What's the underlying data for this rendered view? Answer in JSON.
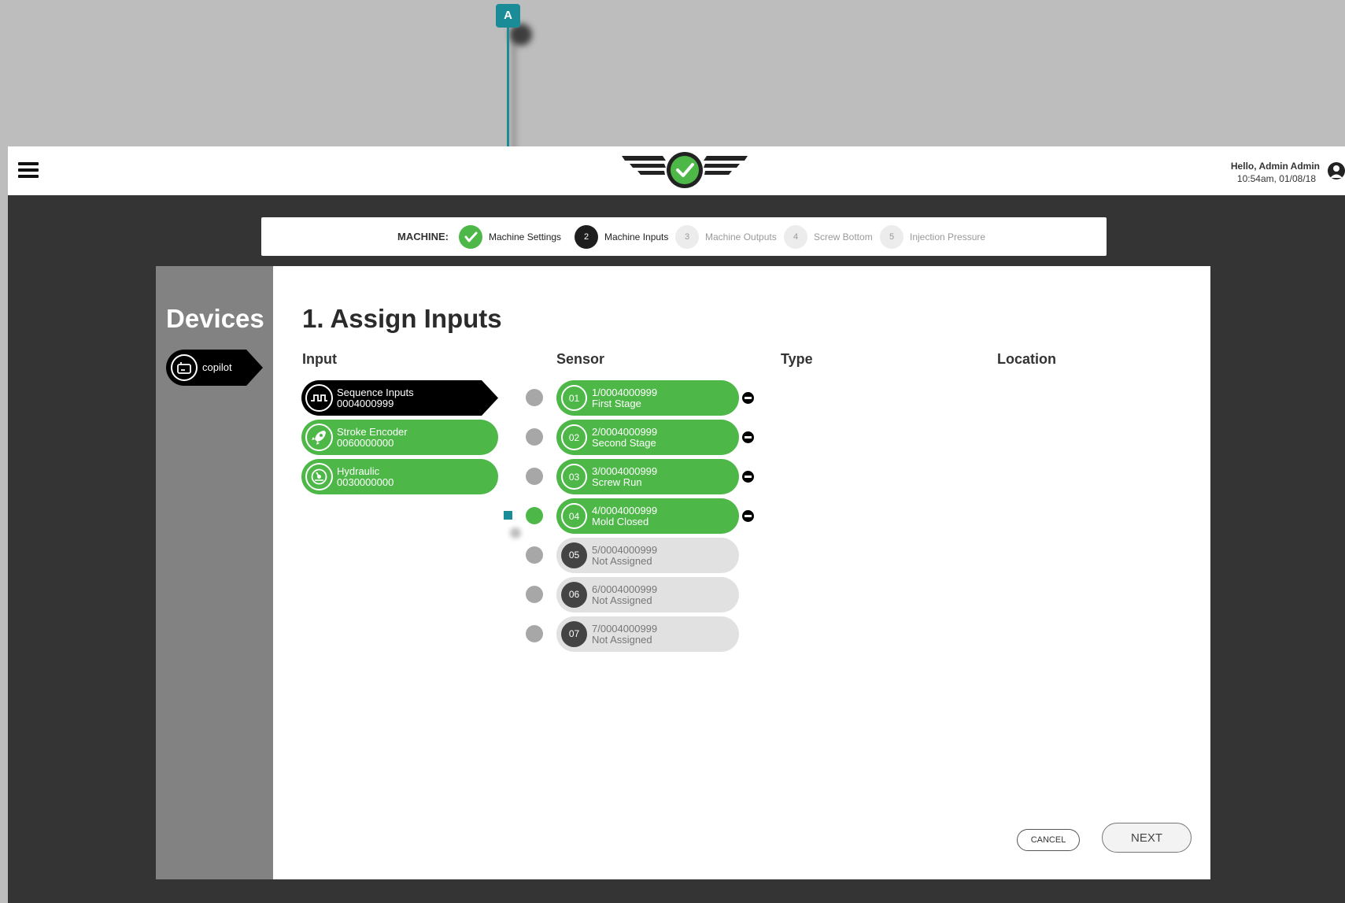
{
  "callout": {
    "label": "A"
  },
  "header": {
    "menu_icon": "hamburger-menu-icon",
    "logo_icon": "winged-checkmark-logo",
    "greeting": "Hello, Admin Admin",
    "datetime": "10:54am, 01/08/18",
    "user_icon": "user-account-icon"
  },
  "stepper": {
    "label": "MACHINE:",
    "steps": [
      {
        "num": "",
        "label": "Machine Settings",
        "state": "complete"
      },
      {
        "num": "2",
        "label": "Machine Inputs",
        "state": "active"
      },
      {
        "num": "3",
        "label": "Machine Outputs",
        "state": "future"
      },
      {
        "num": "4",
        "label": "Screw Bottom",
        "state": "future"
      },
      {
        "num": "5",
        "label": "Injection Pressure",
        "state": "future"
      }
    ]
  },
  "devices": {
    "title": "Devices",
    "items": [
      {
        "label": "copilot",
        "icon": "device-module-icon"
      }
    ]
  },
  "main": {
    "title": "1. Assign Inputs",
    "columns": {
      "input": "Input",
      "sensor": "Sensor",
      "type": "Type",
      "location": "Location"
    },
    "inputs": [
      {
        "name": "Sequence Inputs",
        "serial": "0004000999",
        "icon": "square-wave-icon",
        "selected": true
      },
      {
        "name": "Stroke Encoder",
        "serial": "0060000000",
        "icon": "rocket-icon",
        "selected": false
      },
      {
        "name": "Hydraulic",
        "serial": "0030000000",
        "icon": "pressure-gauge-icon",
        "selected": false
      }
    ],
    "sensors": [
      {
        "num": "01",
        "id": "1/0004000999",
        "label": "First Stage",
        "assigned": true,
        "connected": false
      },
      {
        "num": "02",
        "id": "2/0004000999",
        "label": "Second Stage",
        "assigned": true,
        "connected": false
      },
      {
        "num": "03",
        "id": "3/0004000999",
        "label": "Screw Run",
        "assigned": true,
        "connected": false
      },
      {
        "num": "04",
        "id": "4/0004000999",
        "label": "Mold Closed",
        "assigned": true,
        "connected": true
      },
      {
        "num": "05",
        "id": "5/0004000999",
        "label": "Not Assigned",
        "assigned": false,
        "connected": false
      },
      {
        "num": "06",
        "id": "6/0004000999",
        "label": "Not Assigned",
        "assigned": false,
        "connected": false
      },
      {
        "num": "07",
        "id": "7/0004000999",
        "label": "Not Assigned",
        "assigned": false,
        "connected": false
      }
    ],
    "cancel_label": "CANCEL",
    "next_label": "NEXT"
  },
  "colors": {
    "accent_green": "#4db848",
    "callout_teal": "#1a8c98",
    "dark_bg": "#343434"
  }
}
